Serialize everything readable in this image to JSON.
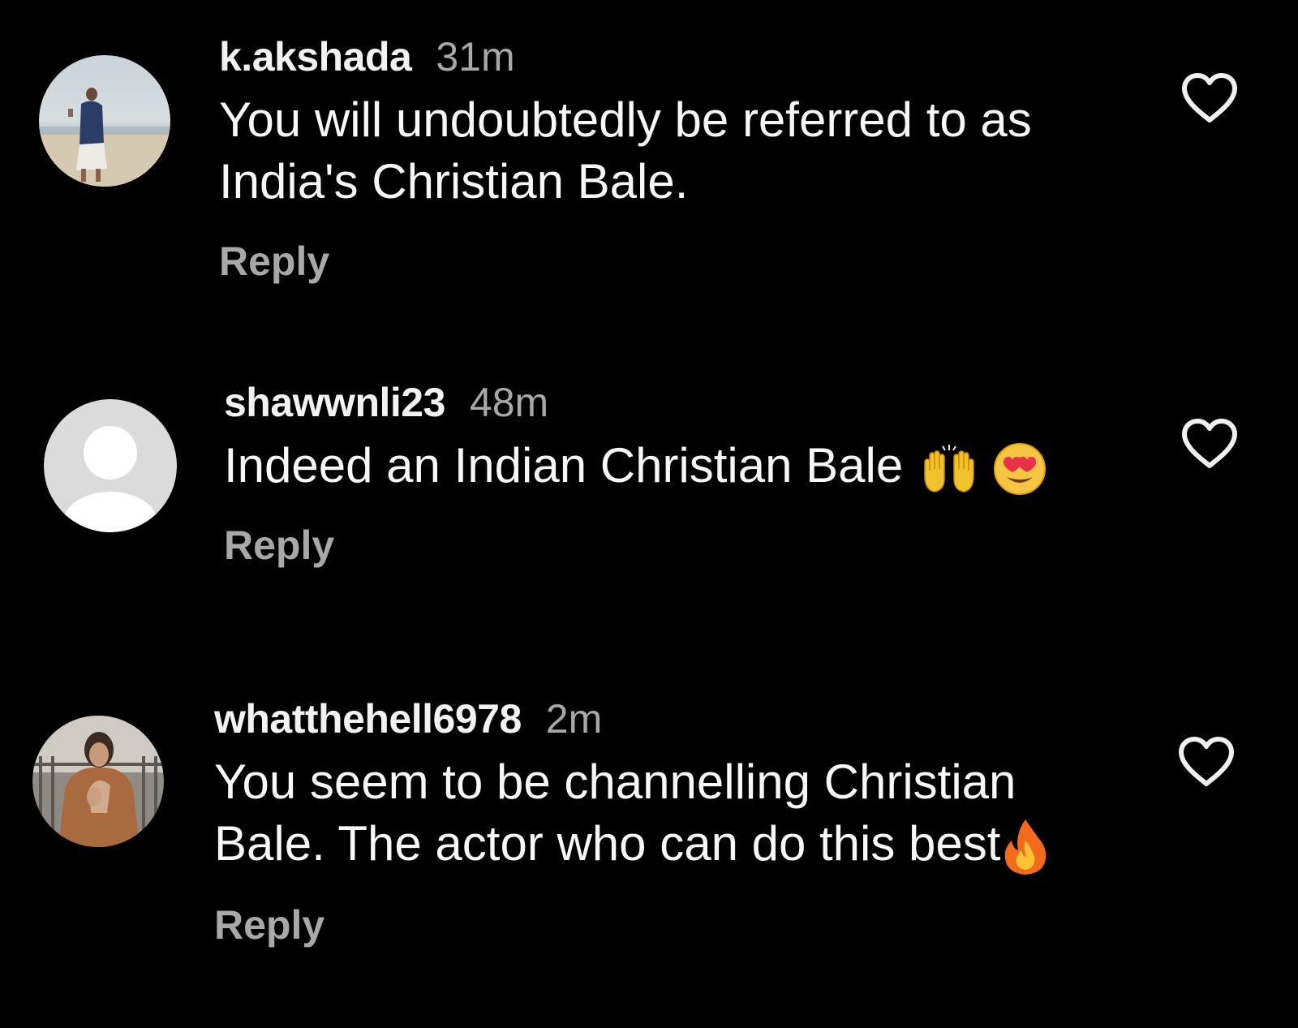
{
  "comments": [
    {
      "username": "k.akshada",
      "time": "31m",
      "text_lines": [
        "You will undoubtedly be referred to as",
        "India's Christian Bale."
      ],
      "reply_label": "Reply",
      "avatar_icon": "profile-photo-beach"
    },
    {
      "username": "shawwnli23",
      "time": "48m",
      "text_lines": [
        "Indeed an Indian Christian Bale"
      ],
      "emojis": [
        "raising-hands-emoji",
        "heart-eyes-emoji"
      ],
      "reply_label": "Reply",
      "avatar_icon": "default-avatar-icon"
    },
    {
      "username": "whatthehell6978",
      "time": "2m",
      "text_lines": [
        "You seem to be channelling Christian",
        "Bale. The actor who can do this best"
      ],
      "emojis": [
        "fire-emoji"
      ],
      "reply_label": "Reply",
      "avatar_icon": "profile-photo-person"
    }
  ],
  "colors": {
    "background": "#000000",
    "username": "#f2f2f2",
    "muted": "#a8a8a8",
    "text": "#f7f7f7"
  },
  "like_icon": "heart-outline-icon"
}
